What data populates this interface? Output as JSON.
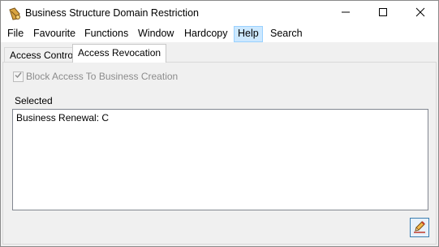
{
  "window": {
    "title": "Business Structure Domain Restriction",
    "icon": "scroll-key-icon",
    "controls": [
      "minimize-icon",
      "maximize-icon",
      "close-icon"
    ]
  },
  "menubar": {
    "items": [
      {
        "label": "File"
      },
      {
        "label": "Favourite"
      },
      {
        "label": "Functions"
      },
      {
        "label": "Window"
      },
      {
        "label": "Hardcopy"
      },
      {
        "label": "Help",
        "active": true
      },
      {
        "label": "Search"
      }
    ]
  },
  "tabs": [
    {
      "label": "Access Control",
      "selected": false
    },
    {
      "label": "Access Revocation",
      "selected": true
    }
  ],
  "panel": {
    "checkbox": {
      "label": "Block Access To Business Creation",
      "checked": true,
      "disabled": true
    },
    "selected_label": "Selected",
    "selected_items": [
      "Business Renewal: C"
    ],
    "edit_button_icon": "pencil-icon"
  },
  "colors": {
    "menu_highlight": "#cce8ff",
    "panel_background": "#f0f0f0",
    "disabled_text": "#8c8c8c"
  }
}
